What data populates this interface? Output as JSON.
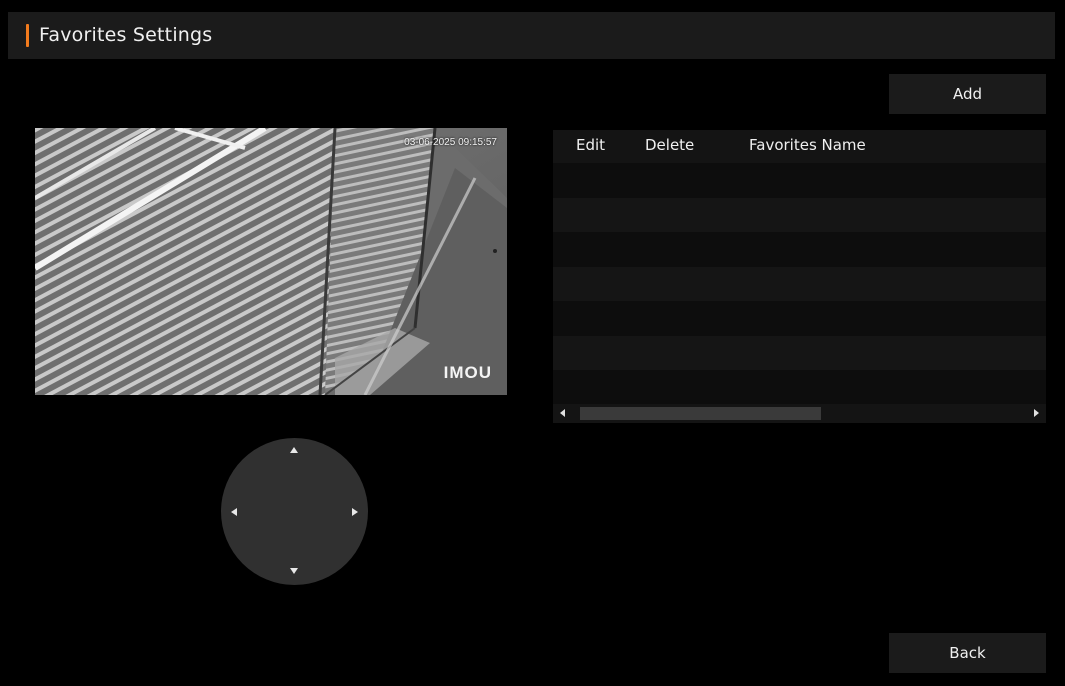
{
  "header": {
    "title": "Favorites Settings",
    "accent_color": "#f27b1d"
  },
  "toolbar": {
    "add_label": "Add"
  },
  "camera": {
    "timestamp": "03-06-2025 09:15:57",
    "watermark": "IMOU"
  },
  "table": {
    "columns": [
      "Edit",
      "Delete",
      "Favorites Name"
    ],
    "rows": []
  },
  "ptz": {
    "directions": [
      "up-icon",
      "down-icon",
      "left-icon",
      "right-icon"
    ]
  },
  "footer": {
    "back_label": "Back"
  }
}
